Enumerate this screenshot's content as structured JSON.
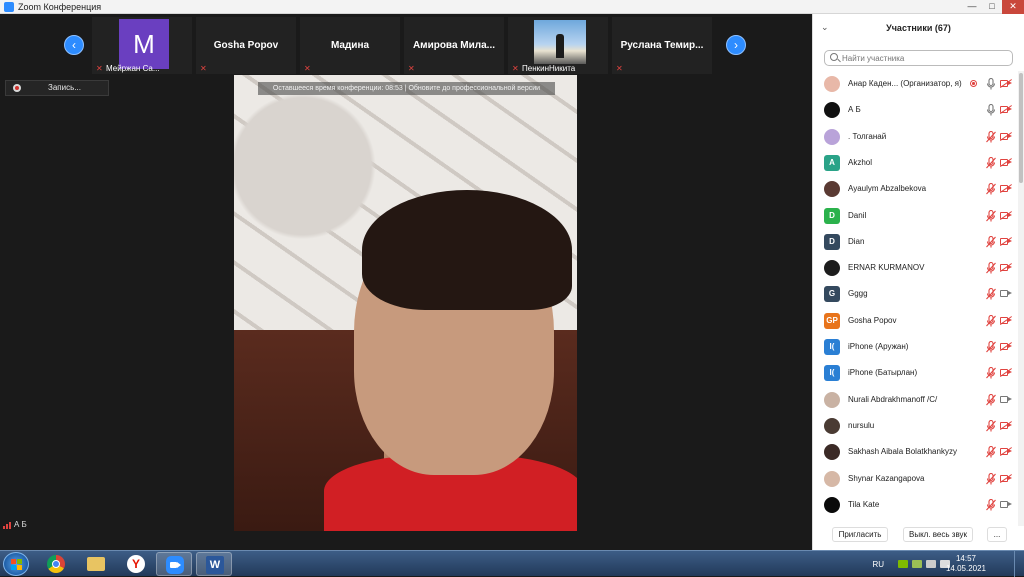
{
  "window": {
    "title": "Zoom Конференция",
    "controls": {
      "minimize": "—",
      "maximize": "□",
      "close": "✕"
    }
  },
  "gallery": {
    "prev_arrow": "‹",
    "next_arrow": "›",
    "tiles": [
      {
        "name": "",
        "bar_label": "Мейржан Са...",
        "avatar_letter": "M",
        "avatar_color": "#6a3fc0",
        "muted": true
      },
      {
        "name": "Gosha Popov",
        "bar_label": "",
        "muted": true
      },
      {
        "name": "Мадина",
        "bar_label": "",
        "muted": true
      },
      {
        "name": "Амирова Мила...",
        "bar_label": "",
        "muted": true
      },
      {
        "name": "",
        "bar_label": "ПенкинНикита",
        "photo": true,
        "muted": true
      },
      {
        "name": "Руслана Темир...",
        "bar_label": "",
        "muted": true
      }
    ]
  },
  "recording": {
    "label": "Запись..."
  },
  "main_video": {
    "banner": "Оставшееся время конференции: 08:53 | Обновите до профессиональной версии"
  },
  "self_view": {
    "name": "А Б"
  },
  "participants": {
    "title": "Участники (67)",
    "collapse_icon": "⌄",
    "search_placeholder": "Найти участника",
    "list": [
      {
        "name": "Анар Каден... (Организатор, я)",
        "initials": "",
        "avatar_color": "#e8b8a8",
        "recording": true,
        "mic": "on",
        "video": "off"
      },
      {
        "name": "А Б",
        "initials": "",
        "avatar_color": "#111111",
        "mic": "on",
        "video": "off"
      },
      {
        "name": ". Толганай",
        "initials": "",
        "avatar_color": "#b9a3d9",
        "mic": "muted",
        "video": "off"
      },
      {
        "name": "Akzhol",
        "initials": "A",
        "avatar_color": "#2aa388",
        "mic": "muted",
        "video": "off"
      },
      {
        "name": "Ayaulym Abzalbekova",
        "initials": "",
        "avatar_color": "#5a3a33",
        "mic": "muted",
        "video": "off"
      },
      {
        "name": "Danil",
        "initials": "D",
        "avatar_color": "#2bb24c",
        "mic": "muted",
        "video": "off"
      },
      {
        "name": "Dian",
        "initials": "D",
        "avatar_color": "#34495e",
        "mic": "muted",
        "video": "off"
      },
      {
        "name": "ERNAR KURMANOV",
        "initials": "",
        "avatar_color": "#1d1d1d",
        "mic": "muted",
        "video": "off"
      },
      {
        "name": "Gggg",
        "initials": "G",
        "avatar_color": "#34495e",
        "mic": "muted",
        "video": "on"
      },
      {
        "name": "Gosha Popov",
        "initials": "GP",
        "avatar_color": "#e8741b",
        "mic": "muted",
        "video": "off"
      },
      {
        "name": "iPhone (Аружан)",
        "initials": "I(",
        "avatar_color": "#2a7fd4",
        "mic": "muted",
        "video": "off"
      },
      {
        "name": "iPhone (Батырлан)",
        "initials": "I(",
        "avatar_color": "#2a7fd4",
        "mic": "muted",
        "video": "off"
      },
      {
        "name": "Nurali Abdrakhmanoff /C/",
        "initials": "",
        "avatar_color": "#c9b2a3",
        "mic": "muted",
        "video": "on"
      },
      {
        "name": "nursulu",
        "initials": "",
        "avatar_color": "#4a3b33",
        "mic": "muted",
        "video": "off"
      },
      {
        "name": "Sakhash Aibala Bolatkhankyzy",
        "initials": "",
        "avatar_color": "#3b2a26",
        "mic": "muted",
        "video": "off"
      },
      {
        "name": "Shynar Kazangapova",
        "initials": "",
        "avatar_color": "#d6b8a6",
        "mic": "muted",
        "video": "off"
      },
      {
        "name": "Tila Kate",
        "initials": "",
        "avatar_color": "#0a0a0a",
        "mic": "muted",
        "video": "on"
      }
    ],
    "footer": {
      "invite": "Пригласить",
      "mute_all": "Выкл. весь звук",
      "more": "..."
    }
  },
  "taskbar": {
    "apps": [
      "chrome-icon",
      "explorer-icon",
      "yandex-icon",
      "zoom-icon",
      "word-icon"
    ],
    "yandex_glyph": "Y",
    "word_glyph": "W",
    "lang": "RU",
    "time": "14:57",
    "date": "14.05.2021"
  },
  "colors": {
    "zoom_blue": "#2d8cff",
    "mute_red": "#e0433f",
    "taskbar": "#2b4a70"
  }
}
